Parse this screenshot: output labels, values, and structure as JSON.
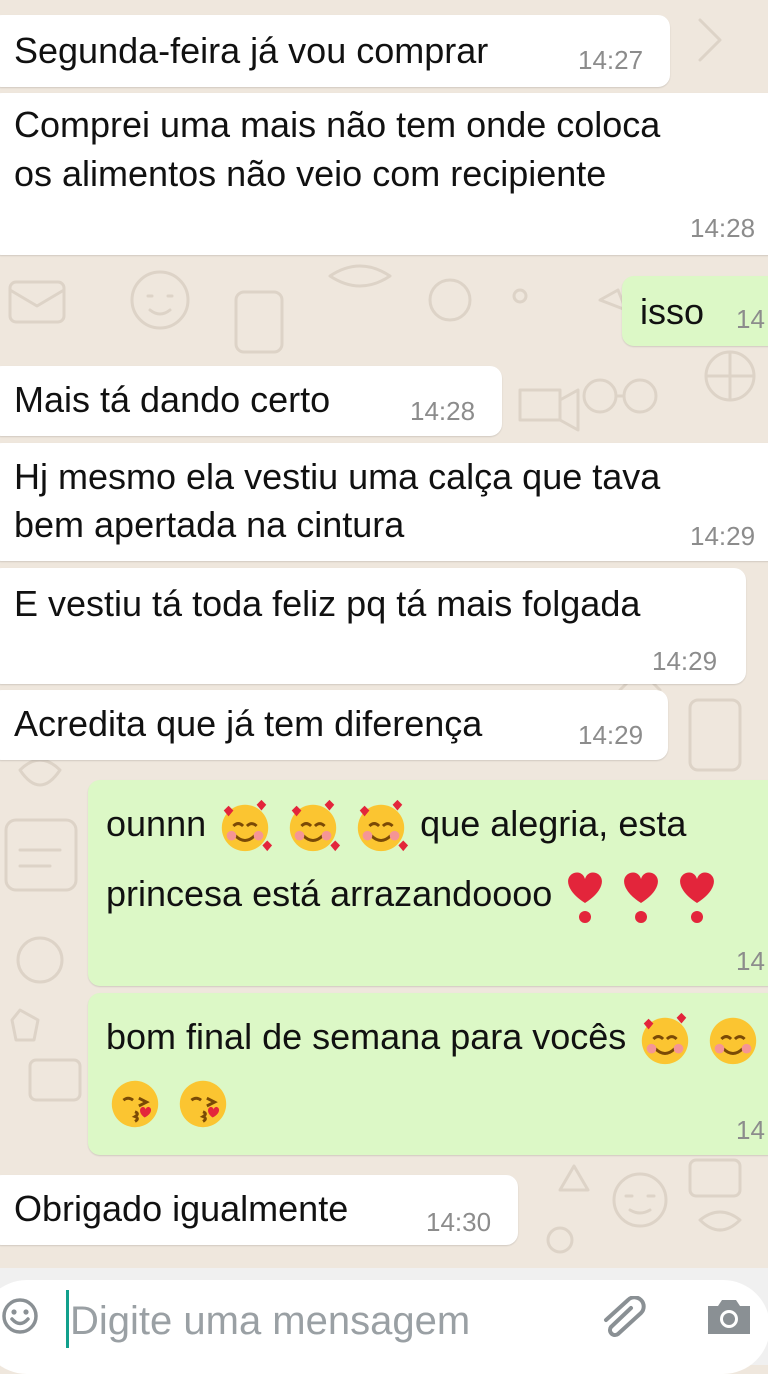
{
  "messages": [
    {
      "direction": "in",
      "text": "Segunda-feira já vou comprar",
      "time": "14:27"
    },
    {
      "direction": "in",
      "line1": "Comprei uma mais não tem onde coloca",
      "line2": "os alimentos não veio com recipiente",
      "time": "14:28"
    },
    {
      "direction": "out",
      "text": "isso",
      "time": "14"
    },
    {
      "direction": "in",
      "text": "Mais tá dando certo",
      "time": "14:28"
    },
    {
      "direction": "in",
      "line1": "Hj mesmo ela vestiu uma calça que tava",
      "line2": "bem apertada na cintura",
      "time": "14:29"
    },
    {
      "direction": "in",
      "text": "E vestiu tá toda feliz pq tá mais folgada",
      "time": "14:29"
    },
    {
      "direction": "in",
      "text": "Acredita que já tem diferença",
      "time": "14:29"
    },
    {
      "direction": "out",
      "line1_a": "ounnn",
      "line1_b": "que alegria, esta",
      "line2": "princesa está arrazandoooo",
      "time": "14",
      "emojis": [
        "smiling-face-with-hearts",
        "smiling-face-with-hearts",
        "smiling-face-with-hearts",
        "red-heart-exclamation",
        "red-heart-exclamation",
        "red-heart-exclamation"
      ]
    },
    {
      "direction": "out",
      "line1": "bom final de semana para vocês",
      "time": "14",
      "emojis": [
        "smiling-face-with-hearts",
        "smiling-face-with-hearts",
        "face-blowing-kiss",
        "face-blowing-kiss"
      ]
    },
    {
      "direction": "in",
      "text": "Obrigado igualmente",
      "time": "14:30"
    }
  ],
  "composer": {
    "placeholder": "Digite uma mensagem",
    "icons": [
      "emoji-icon",
      "attach-icon",
      "camera-icon"
    ]
  },
  "colors": {
    "background": "#efe7dd",
    "incoming_bubble": "#ffffff",
    "outgoing_bubble": "#dcf8c6",
    "timestamp": "#8c8c8c",
    "cursor": "#11a08c"
  }
}
